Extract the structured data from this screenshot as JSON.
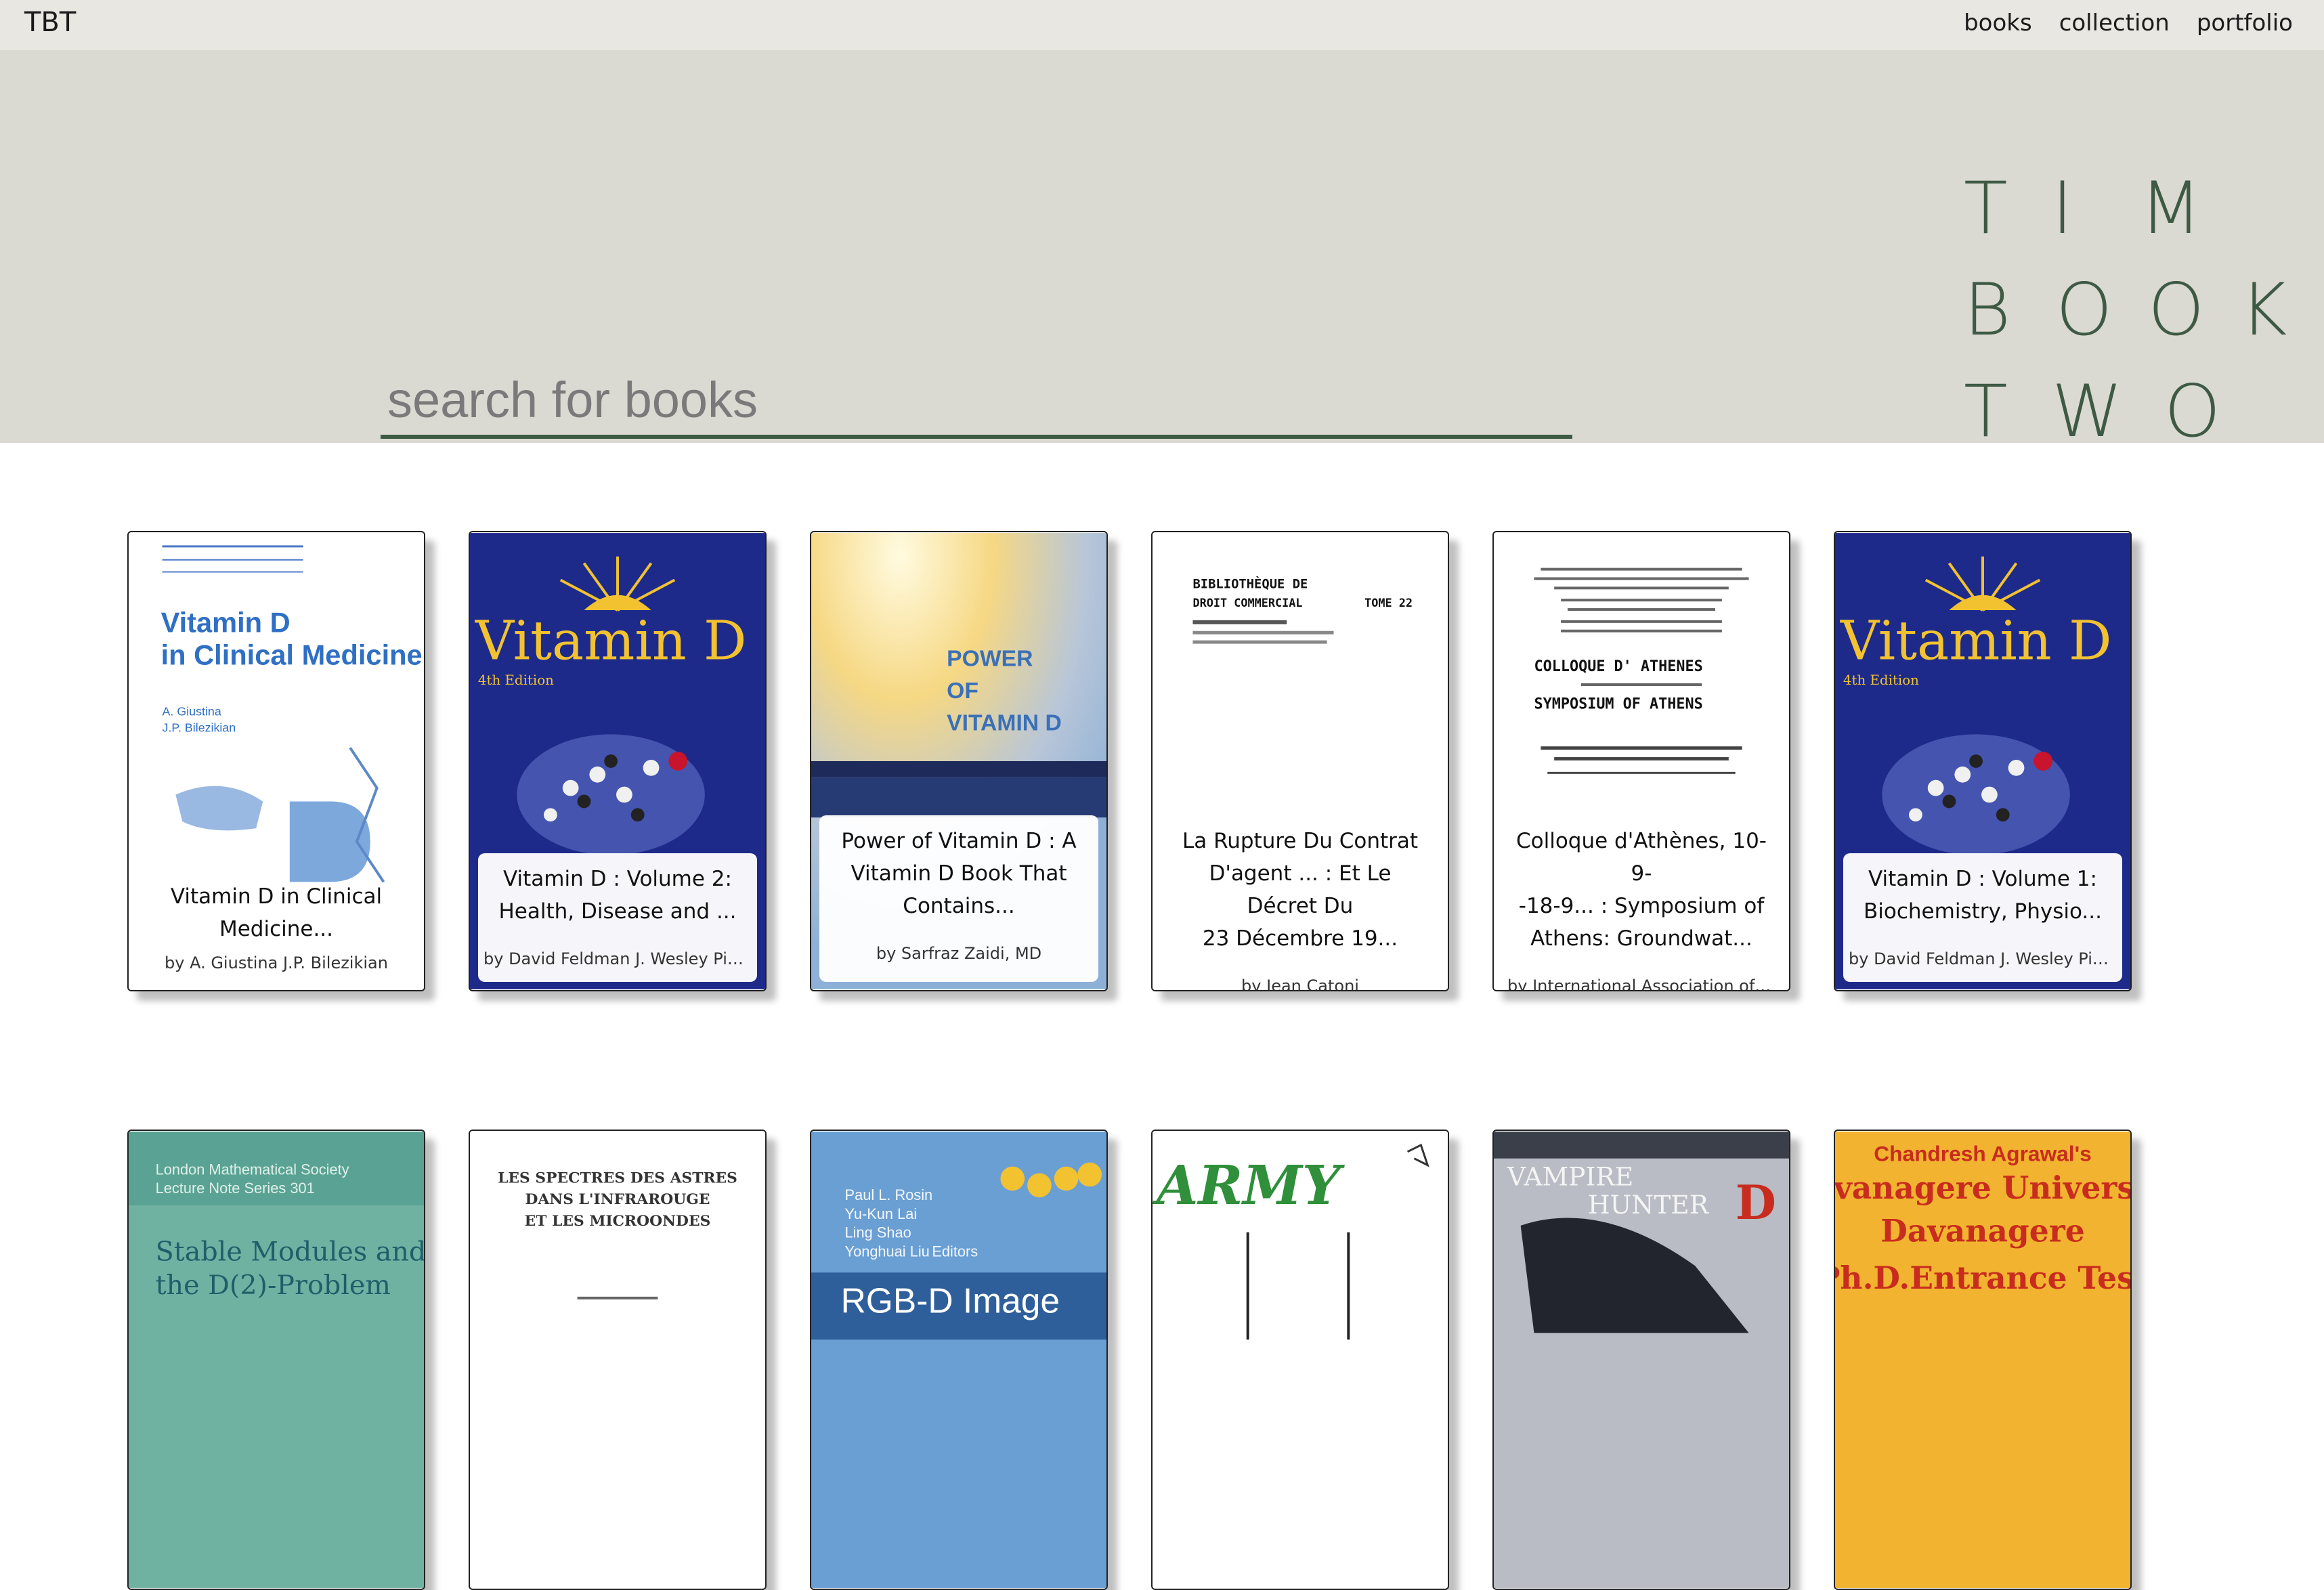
{
  "topbar": {
    "brand": "TBT",
    "nav": [
      "books",
      "collection",
      "portfolio"
    ]
  },
  "hero": {
    "search_placeholder": "search for books",
    "logo_rows": [
      [
        "T",
        "I",
        "M"
      ],
      [
        "B",
        "O",
        "O",
        "K"
      ],
      [
        "T",
        "W",
        "O"
      ]
    ]
  },
  "colors": {
    "accent": "#3e5a44",
    "hero_bg": "#dad9d2",
    "topbar_bg": "#e8e7e2"
  },
  "books_row1": [
    {
      "title1": "Vitamin D in Clinical",
      "title2": "Medicine...",
      "author": "by A. Giustina J.P. Bilezikian",
      "cover_texts": [
        "Vitamin D",
        "in Clinical Medicine",
        "A. Giustina",
        "J.P. Bilezikian"
      ]
    },
    {
      "title1": "Vitamin D : Volume 2:",
      "title2": "Health, Disease and ...",
      "author": "by David Feldman J. Wesley Pike R...",
      "cover_texts": [
        "Vitamin D",
        "4th Edition"
      ]
    },
    {
      "title1": "Power of Vitamin D : A",
      "title2": "Vitamin D Book That",
      "title3": "Contains...",
      "author": "by Sarfraz Zaidi, MD",
      "cover_texts": [
        "POWER",
        "OF",
        "VITAMIN D"
      ]
    },
    {
      "title1": "La Rupture Du Contrat",
      "title2": "D'agent ... : Et Le Décret Du",
      "title3": "23 Décembre 19...",
      "author": "by Jean Catoni",
      "cover_texts": [
        "BIBLIOTHÈQUE DE",
        "DROIT COMMERCIAL",
        "TOME 22"
      ]
    },
    {
      "title1": "Colloque d'Athènes, 10-9-",
      "title2": "-18-9... : Symposium of",
      "title3": "Athens: Groundwat...",
      "author": "by International Association of S...",
      "cover_texts": [
        "COLLOQUE D' ATHENES",
        "SYMPOSIUM OF ATHENS"
      ]
    },
    {
      "title1": "Vitamin D : Volume 1:",
      "title2": "Biochemistry, Physio...",
      "author": "by David Feldman J. Wesley Pike R...",
      "cover_texts": [
        "Vitamin D",
        "4th Edition"
      ]
    }
  ],
  "books_row2": [
    {
      "cover_texts": [
        "London Mathematical Society",
        "Lecture Note Series 301",
        "Stable Modules and",
        "the D(2)-Problem"
      ]
    },
    {
      "cover_texts": [
        "LES SPECTRES DES ASTRES",
        "DANS L'INFRAROUGE",
        "ET LES MICROONDES"
      ]
    },
    {
      "cover_texts": [
        "Paul L. Rosin",
        "Yu-Kun Lai",
        "Ling Shao",
        "Yonghuai Liu",
        "Editors",
        "RGB-D Image"
      ]
    },
    {
      "cover_texts": [
        "ARMY"
      ]
    },
    {
      "cover_texts": [
        "VAMPIRE",
        "HUNTER",
        "D"
      ]
    },
    {
      "cover_texts": [
        "Chandresh Agrawal's",
        "Davanagere University",
        "Davanagere",
        "Ph.D.Entrance Test"
      ]
    }
  ]
}
